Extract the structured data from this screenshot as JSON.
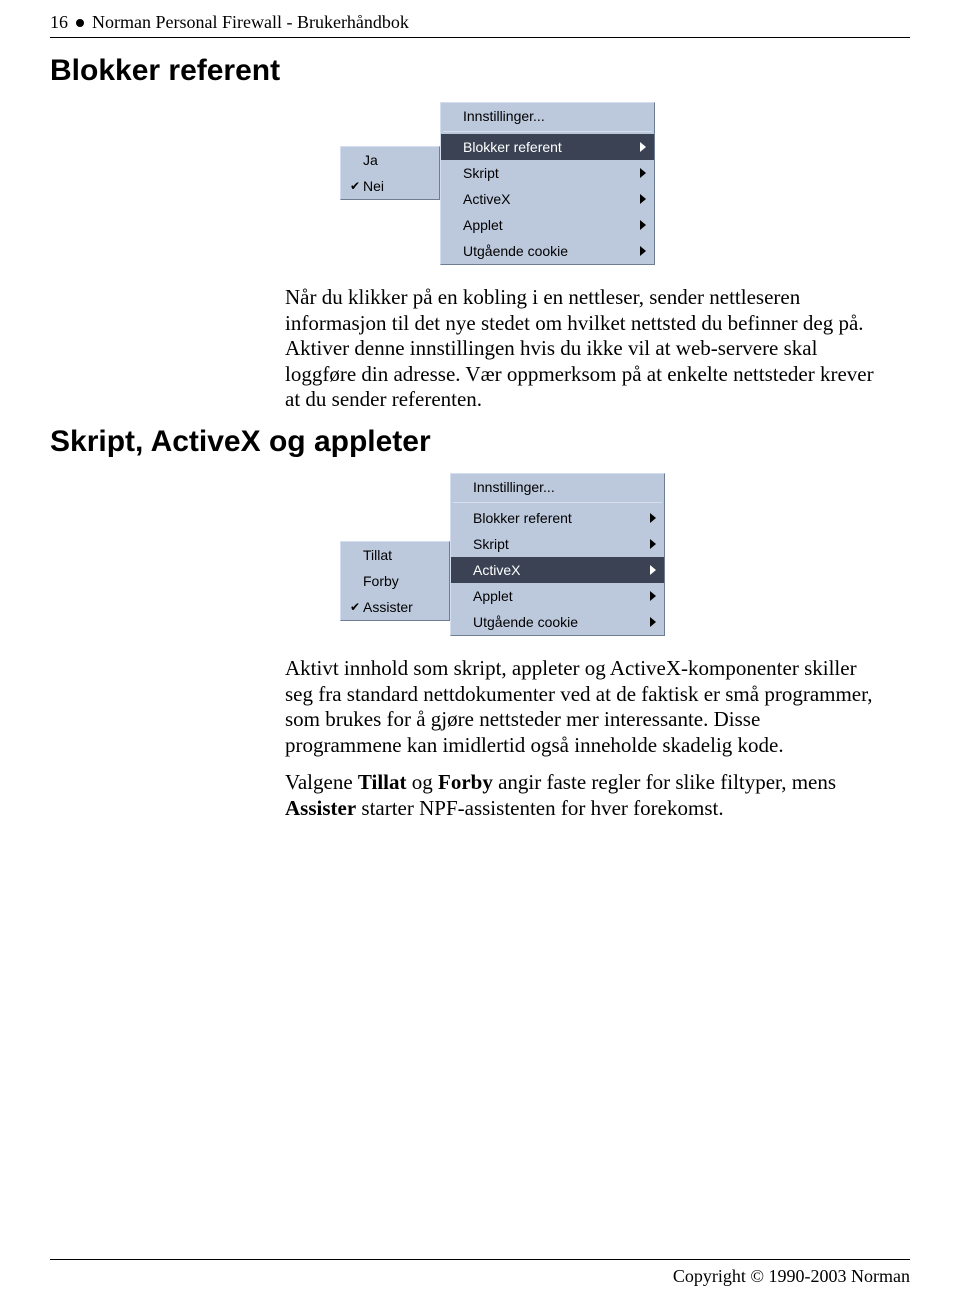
{
  "header": {
    "page_number": "16",
    "title": "Norman Personal Firewall - Brukerhåndbok"
  },
  "section1": {
    "heading": "Blokker referent",
    "menu": {
      "left": {
        "items": [
          {
            "check": "",
            "label": "Ja"
          },
          {
            "check": "✔",
            "label": "Nei"
          }
        ]
      },
      "right": {
        "top": "Innstillinger...",
        "items": [
          {
            "label": "Blokker referent",
            "selected": true
          },
          {
            "label": "Skript",
            "selected": false
          },
          {
            "label": "ActiveX",
            "selected": false
          },
          {
            "label": "Applet",
            "selected": false
          },
          {
            "label": "Utgående cookie",
            "selected": false
          }
        ]
      }
    },
    "paragraph": "Når du klikker på en kobling i en nettleser, sender nettleseren informasjon til det nye stedet om hvilket nettsted du befinner deg på. Aktiver denne innstillingen hvis du ikke vil at web-servere skal loggføre din adresse. Vær oppmerksom på at enkelte nettsteder krever at du sender referenten."
  },
  "section2": {
    "heading": "Skript, ActiveX og appleter",
    "menu": {
      "left": {
        "items": [
          {
            "check": "",
            "label": "Tillat"
          },
          {
            "check": "",
            "label": "Forby"
          },
          {
            "check": "✔",
            "label": "Assister"
          }
        ]
      },
      "right": {
        "top": "Innstillinger...",
        "items": [
          {
            "label": "Blokker referent",
            "selected": false
          },
          {
            "label": "Skript",
            "selected": false
          },
          {
            "label": "ActiveX",
            "selected": true
          },
          {
            "label": "Applet",
            "selected": false
          },
          {
            "label": "Utgående cookie",
            "selected": false
          }
        ]
      }
    },
    "paragraph1": "Aktivt innhold som skript, appleter og ActiveX-komponenter skiller seg fra standard nettdokumenter ved at de faktisk er små programmer, som brukes for å gjøre nettsteder mer interessante. Disse programmene kan imidlertid også inneholde skadelig kode.",
    "paragraph2_parts": {
      "a": "Valgene ",
      "b": "Tillat",
      "c": " og ",
      "d": "Forby",
      "e": " angir faste regler for slike filtyper, mens ",
      "f": "Assister",
      "g": " starter NPF-assistenten for hver forekomst."
    }
  },
  "footer": {
    "copyright": "Copyright © 1990-2003 Norman"
  }
}
